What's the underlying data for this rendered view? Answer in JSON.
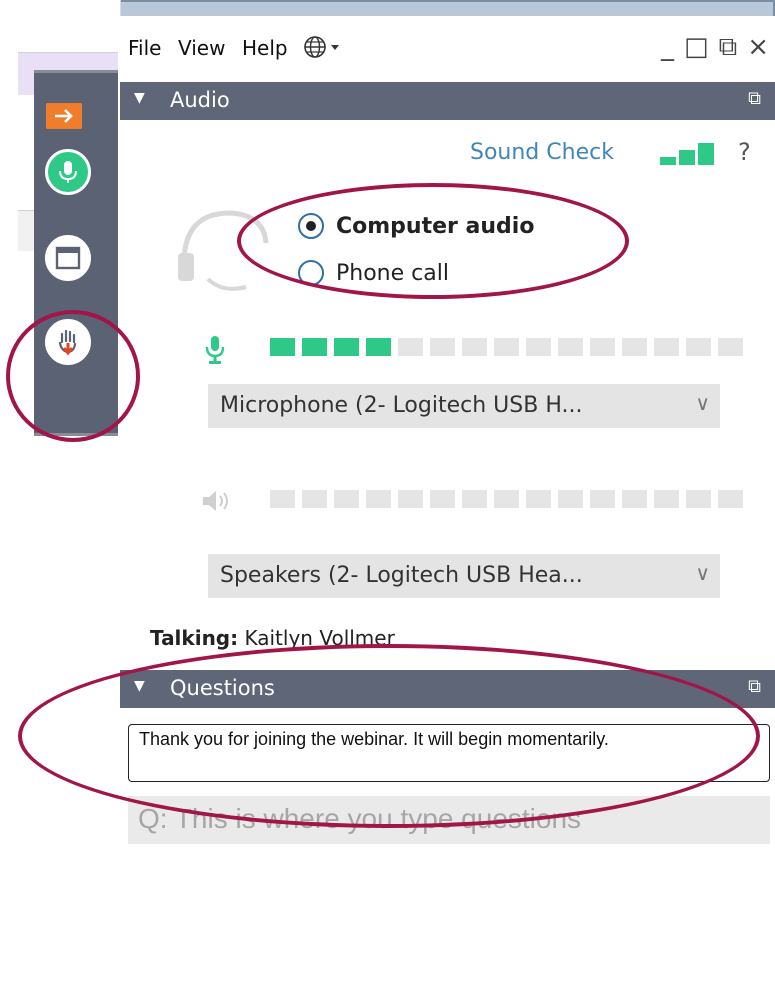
{
  "menu": {
    "file": "File",
    "view": "View",
    "help": "Help",
    "lang_icon": "globe-icon"
  },
  "window_controls": {
    "minimize": "_",
    "maximize": "□",
    "popout": "⧉",
    "close": "×"
  },
  "audio": {
    "header": "Audio",
    "sound_check": "Sound Check",
    "help": "?",
    "radio": [
      {
        "label": "Computer audio",
        "selected": true
      },
      {
        "label": "Phone call",
        "selected": false
      }
    ],
    "mic_level": 0.27,
    "microphone": "Microphone (2- Logitech USB H...",
    "speakers": "Speakers (2- Logitech USB Hea..."
  },
  "talking": {
    "label": "Talking:",
    "name": "Kaitlyn Vollmer"
  },
  "questions": {
    "header": "Questions",
    "message": "Thank you for joining the webinar. It will begin momentarily.",
    "placeholder": "Q: This is where you type questions"
  },
  "colors": {
    "accent_green": "#2fc987",
    "header_bg": "#5e6677",
    "annotation": "#a11548",
    "link": "#3f86b9",
    "orange": "#f07d2c"
  }
}
